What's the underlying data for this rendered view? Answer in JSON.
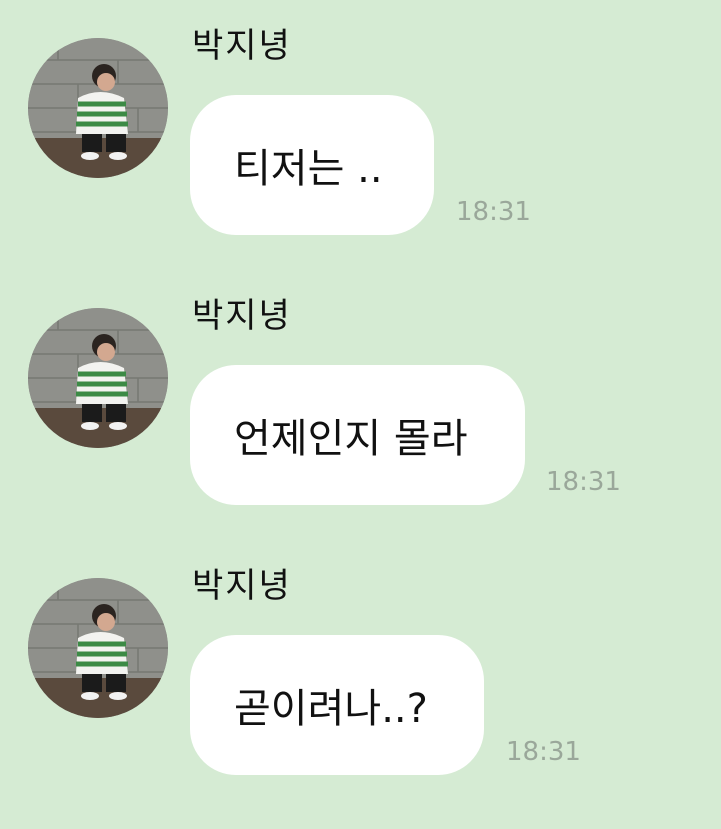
{
  "chat": {
    "background_color": "#d5ebd3",
    "messages": [
      {
        "sender": "박지녕",
        "avatar_icon": "profile-photo-icon",
        "text": "티저는 ..",
        "time": "18:31"
      },
      {
        "sender": "박지녕",
        "avatar_icon": "profile-photo-icon",
        "text": "언제인지 몰라",
        "time": "18:31"
      },
      {
        "sender": "박지녕",
        "avatar_icon": "profile-photo-icon",
        "text": "곧이려나..?",
        "time": "18:31"
      }
    ]
  }
}
